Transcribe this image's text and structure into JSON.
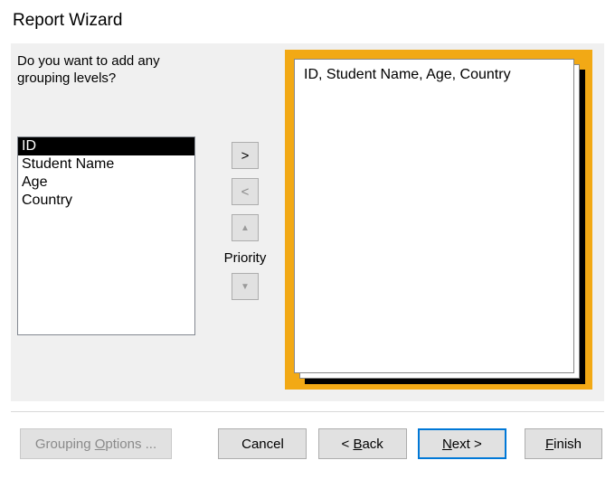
{
  "title": "Report Wizard",
  "prompt": "Do you want to add any grouping levels?",
  "fields": {
    "items": [
      {
        "label": "ID",
        "selected": true
      },
      {
        "label": "Student Name",
        "selected": false
      },
      {
        "label": "Age",
        "selected": false
      },
      {
        "label": "Country",
        "selected": false
      }
    ]
  },
  "controls": {
    "add": ">",
    "remove": "<",
    "priority_label": "Priority",
    "up": "▲",
    "down": "▼"
  },
  "preview": {
    "fields_line": "ID, Student Name, Age, Country"
  },
  "buttons": {
    "grouping_pre": "Grouping ",
    "grouping_u": "O",
    "grouping_post": "ptions ...",
    "cancel": "Cancel",
    "back_pre": "< ",
    "back_u": "B",
    "back_post": "ack",
    "next_u": "N",
    "next_post": "ext >",
    "finish_u": "F",
    "finish_post": "inish"
  }
}
